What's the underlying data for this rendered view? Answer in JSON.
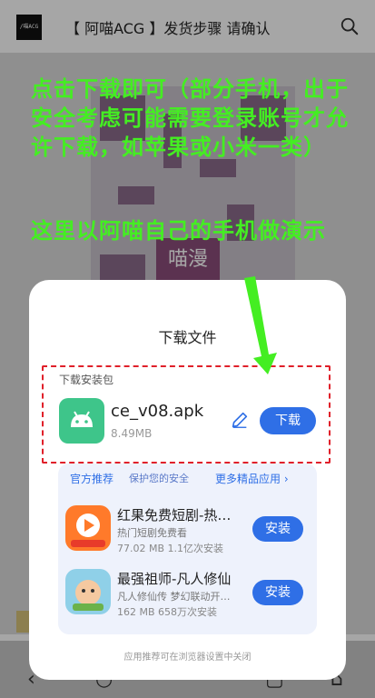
{
  "header": {
    "logo_text": "/喵ACG",
    "title": "【 阿喵ACG 】发货步骤 请确认",
    "search_icon": "search-icon"
  },
  "background": {
    "qr_label": "喵漫"
  },
  "annotations": {
    "line1": "点击下载即可（部分手机，出于安全考虑可能需要登录账号才允许下载，如苹果或小米一类）",
    "line2": "这里以阿喵自己的手机做演示",
    "color": "#44ee22"
  },
  "sheet": {
    "title": "下载文件",
    "section_label": "下载安装包",
    "file": {
      "name": "ce_v08.apk",
      "size": "8.49MB",
      "download_label": "下载"
    },
    "recommend": {
      "head_primary": "官方推荐",
      "head_secondary": "保护您的安全",
      "more": "更多精品应用",
      "apps": [
        {
          "name": "红果免费短剧-热…",
          "desc": "热门短剧免费看",
          "meta": "77.02 MB  1.1亿次安装",
          "install_label": "安装"
        },
        {
          "name": "最强祖师-凡人修仙",
          "desc": "凡人修仙传 梦幻联动开…",
          "meta": "162 MB  658万次安装",
          "install_label": "安装"
        }
      ]
    },
    "footer": "应用推荐可在浏览器设置中关闭"
  },
  "colors": {
    "accent": "#2f6fe6",
    "dashed_box": "#e0202a",
    "apk_icon": "#3ec58a"
  }
}
